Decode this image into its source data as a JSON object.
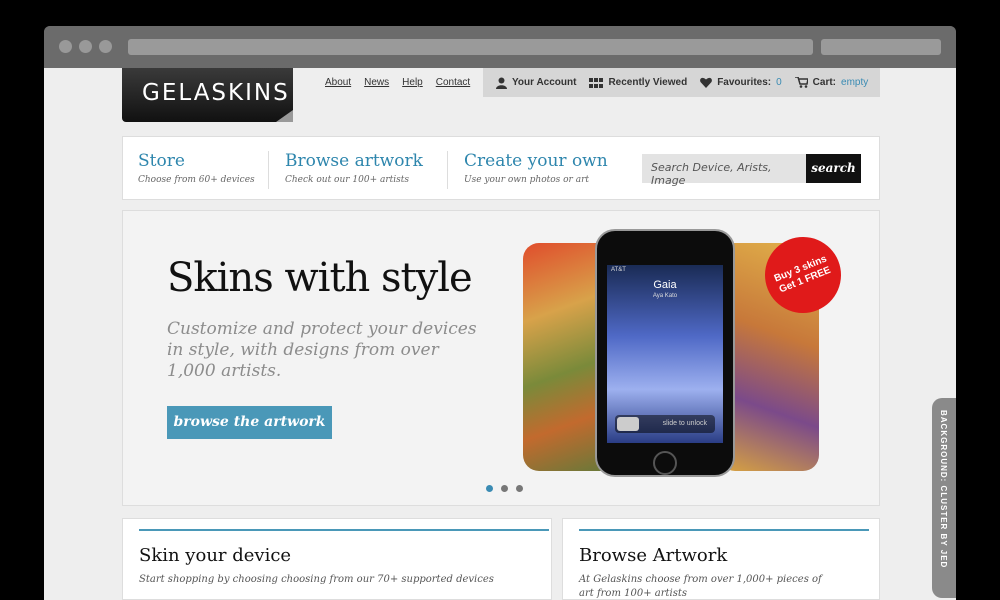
{
  "brand": {
    "logo": "GELASKINS"
  },
  "top_links": [
    "About",
    "News",
    "Help",
    "Contact"
  ],
  "account_bar": {
    "your_account": "Your Account",
    "recently_viewed": "Recently Viewed",
    "favourites_label": "Favourites:",
    "favourites_count": "0",
    "cart_label": "Cart:",
    "cart_value": "empty"
  },
  "nav": {
    "items": [
      {
        "title": "Store",
        "subtitle": "Choose from 60+ devices"
      },
      {
        "title": "Browse artwork",
        "subtitle": "Check out our 100+ artists"
      },
      {
        "title": "Create your own",
        "subtitle": "Use your own photos or art"
      }
    ],
    "search_placeholder": "Search Device, Arists, Image",
    "search_button": "search"
  },
  "hero": {
    "title": "Skins with style",
    "text": "Customize and protect your devices in style, with designs from over 1,000 artists.",
    "button": "browse the artwork",
    "badge_line1": "Buy 3 skins",
    "badge_line2": "Get 1 FREE",
    "phone_screen": {
      "carrier": "AT&T",
      "name": "Gaia",
      "artist": "Aya Kato",
      "slider": "slide to unlock"
    },
    "slides_total": 3,
    "slide_active": 1
  },
  "panels": [
    {
      "title": "Skin your device",
      "subtitle": "Start shopping by choosing choosing from our 70+ supported devices"
    },
    {
      "title": "Browse Artwork",
      "subtitle": "At Gelaskins choose from over 1,000+ pieces of art from 100+ artists"
    }
  ],
  "side_tab": "BACKGROUND: CLUSTER BY JED",
  "colors": {
    "accent": "#3a8bb3",
    "button": "#4a98b8",
    "badge": "#e01a1a"
  }
}
